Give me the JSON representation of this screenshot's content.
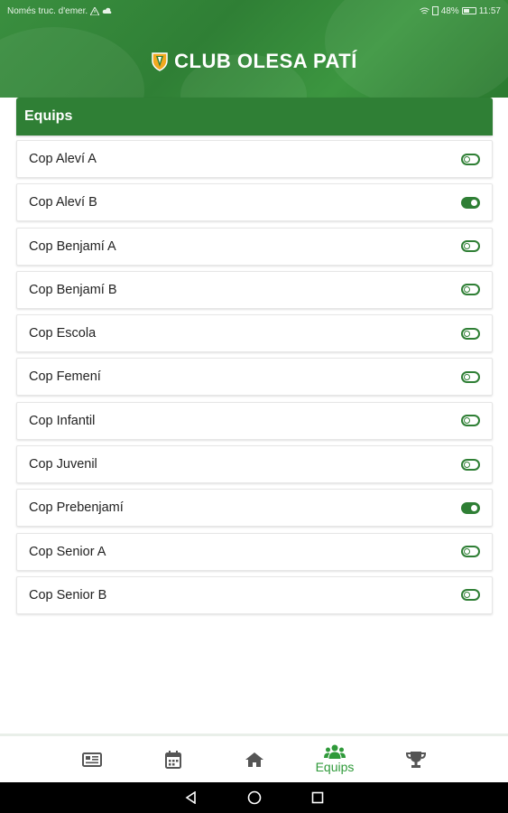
{
  "status_bar": {
    "left_text": "Només truc. d'emer.",
    "battery": "48%",
    "time": "11:57"
  },
  "header": {
    "title": "CLUB OLESA PATÍ",
    "logo_icon": "club-shield-icon"
  },
  "section": {
    "title": "Equips"
  },
  "teams": [
    {
      "name": "Cop Aleví A",
      "enabled": false
    },
    {
      "name": "Cop Aleví B",
      "enabled": true
    },
    {
      "name": "Cop Benjamí A",
      "enabled": false
    },
    {
      "name": "Cop Benjamí B",
      "enabled": false
    },
    {
      "name": "Cop Escola",
      "enabled": false
    },
    {
      "name": "Cop Femení",
      "enabled": false
    },
    {
      "name": "Cop Infantil",
      "enabled": false
    },
    {
      "name": "Cop Juvenil",
      "enabled": false
    },
    {
      "name": "Cop Prebenjamí",
      "enabled": true
    },
    {
      "name": "Cop Senior A",
      "enabled": false
    },
    {
      "name": "Cop Senior B",
      "enabled": false
    }
  ],
  "bottom_nav": {
    "items": [
      {
        "icon": "news-icon",
        "label": ""
      },
      {
        "icon": "calendar-icon",
        "label": ""
      },
      {
        "icon": "home-icon",
        "label": ""
      },
      {
        "icon": "teams-icon",
        "label": "Equips",
        "active": true
      },
      {
        "icon": "trophy-icon",
        "label": ""
      }
    ]
  },
  "colors": {
    "brand_green": "#2f7f35",
    "active_nav": "#2f9a3a",
    "inactive_nav": "#555555"
  }
}
